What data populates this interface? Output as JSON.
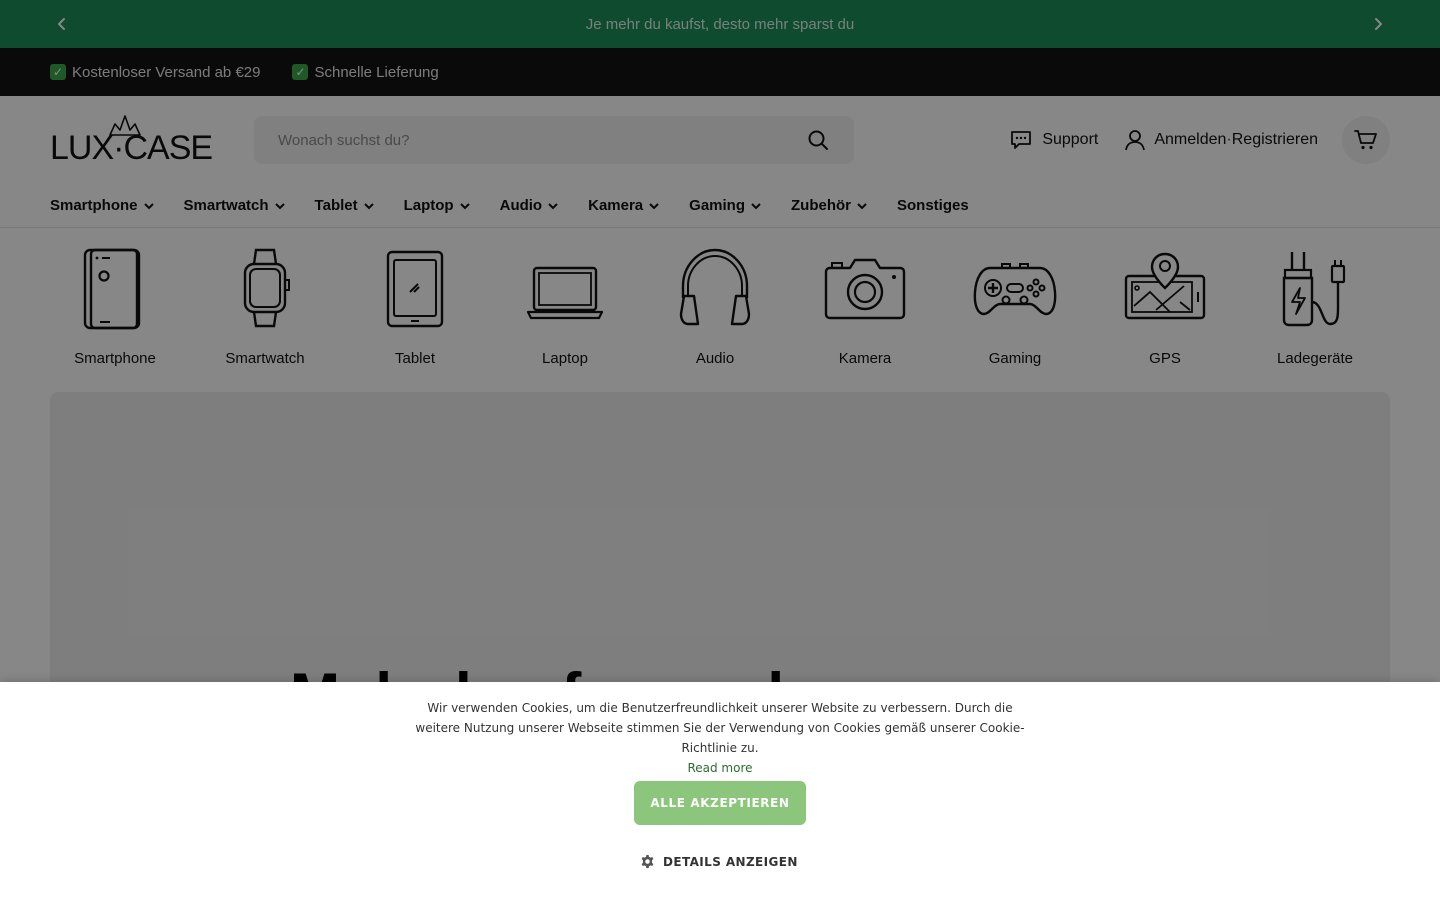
{
  "announcement": {
    "text": "Je mehr du kaufst, desto mehr sparst du",
    "prev_icon": "chevron-left-icon",
    "next_icon": "chevron-right-icon"
  },
  "usp_bar": {
    "items": [
      {
        "label": "Kostenloser Versand ab €29",
        "icon": "check-mark-icon"
      },
      {
        "label": "Schnelle Lieferung",
        "icon": "check-mark-icon"
      }
    ]
  },
  "header": {
    "logo_text": "LUX·CASE",
    "search": {
      "placeholder": "Wonach suchst du?",
      "value": ""
    },
    "support_label": "Support",
    "login_label": "Anmelden",
    "separator": "·",
    "register_label": "Registrieren"
  },
  "nav": {
    "items": [
      {
        "label": "Smartphone",
        "has_dropdown": true
      },
      {
        "label": "Smartwatch",
        "has_dropdown": true
      },
      {
        "label": "Tablet",
        "has_dropdown": true
      },
      {
        "label": "Laptop",
        "has_dropdown": true
      },
      {
        "label": "Audio",
        "has_dropdown": true
      },
      {
        "label": "Kamera",
        "has_dropdown": true
      },
      {
        "label": "Gaming",
        "has_dropdown": true
      },
      {
        "label": "Zubehör",
        "has_dropdown": true
      },
      {
        "label": "Sonstiges",
        "has_dropdown": false
      }
    ]
  },
  "categories": [
    {
      "label": "Smartphone",
      "icon": "smartphone-icon"
    },
    {
      "label": "Smartwatch",
      "icon": "smartwatch-icon"
    },
    {
      "label": "Tablet",
      "icon": "tablet-icon"
    },
    {
      "label": "Laptop",
      "icon": "laptop-icon"
    },
    {
      "label": "Audio",
      "icon": "headphones-icon"
    },
    {
      "label": "Kamera",
      "icon": "camera-icon"
    },
    {
      "label": "Gaming",
      "icon": "gamepad-icon"
    },
    {
      "label": "GPS",
      "icon": "gps-map-icon"
    },
    {
      "label": "Ladegeräte",
      "icon": "charger-icon"
    }
  ],
  "hero": {
    "title": "Mehr kaufen und"
  },
  "cookie_banner": {
    "text": "Wir verwenden Cookies, um die Benutzerfreundlichkeit unserer Website zu verbessern. Durch die weitere Nutzung unserer Webseite stimmen Sie der Verwendung von Cookies gemäß unserer Cookie-Richtlinie zu.",
    "read_more": "Read more",
    "accept_label": "ALLE AKZEPTIEREN",
    "details_label": "DETAILS ANZEIGEN"
  },
  "colors": {
    "announcement_bg": "#1c8f5a",
    "usp_bg": "#141414",
    "accept_button": "#8cc57c",
    "link": "#2a6e2d"
  }
}
